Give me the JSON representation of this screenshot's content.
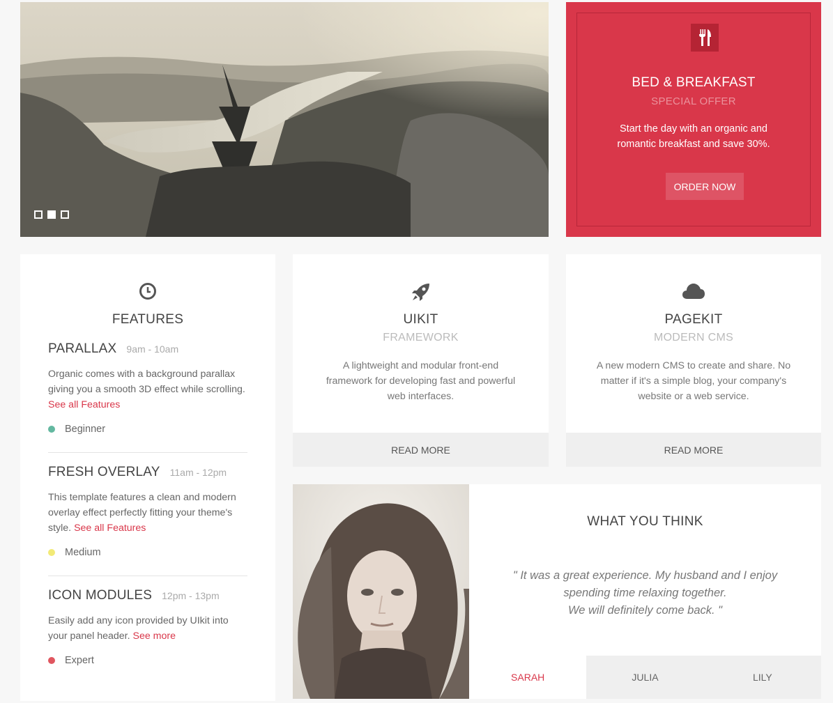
{
  "slideshow": {
    "slides_count": 3,
    "active_index": 1
  },
  "offer": {
    "icon": "restaurant-icon",
    "title": "BED & BREAKFAST",
    "subtitle": "SPECIAL OFFER",
    "text": "Start the day with an organic and romantic breakfast and save 30%.",
    "button": "ORDER NOW",
    "colors": {
      "background": "#d9374a",
      "icon_bg": "#b52434"
    }
  },
  "features": {
    "icon": "clock-icon",
    "title": "FEATURES",
    "items": [
      {
        "name": "PARALLAX",
        "time": "9am - 10am",
        "desc": "Organic comes with a background parallax giving you a smooth 3D effect while scrolling.",
        "link": "See all Features",
        "level": "Beginner",
        "level_color": "#63b8a0"
      },
      {
        "name": "FRESH OVERLAY",
        "time": "11am - 12pm",
        "desc": "This template features a clean and modern overlay effect perfectly fitting your theme's style.",
        "link": "See all Features",
        "level": "Medium",
        "level_color": "#f2ea77"
      },
      {
        "name": "ICON MODULES",
        "time": "12pm - 13pm",
        "desc": "Easily add any icon provided by UIkit into your panel header.",
        "link": "See more",
        "level": "Expert",
        "level_color": "#e0565f"
      }
    ]
  },
  "cards": [
    {
      "icon": "rocket-icon",
      "title": "UIKIT",
      "subtitle": "FRAMEWORK",
      "text": "A lightweight and modular front-end framework for developing fast and powerful web interfaces.",
      "button": "READ MORE"
    },
    {
      "icon": "cloud-icon",
      "title": "PAGEKIT",
      "subtitle": "MODERN CMS",
      "text": "A new modern CMS to create and share. No matter if it's a simple blog, your company's website or a web service.",
      "button": "READ MORE"
    }
  ],
  "testimonial": {
    "title": "WHAT YOU THINK",
    "quote_lines": [
      "\" It was a great experience. My husband and I enjoy",
      "spending time relaxing together.",
      "We will definitely come back. \""
    ],
    "tabs": [
      "SARAH",
      "JULIA",
      "LILY"
    ],
    "active_tab": 0
  },
  "colors": {
    "accent": "#d9374a",
    "page_bg": "#f7f7f7",
    "panel_bg": "#ffffff",
    "button_bg": "#efefef"
  }
}
